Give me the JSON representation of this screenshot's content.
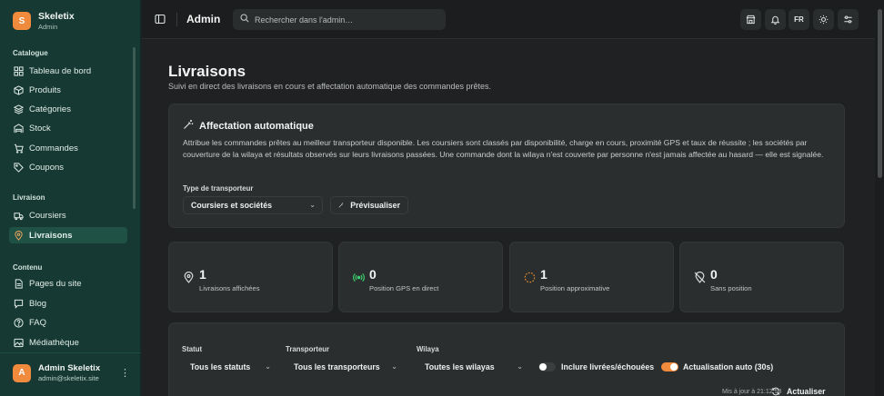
{
  "brand": {
    "logo_letter": "S",
    "title": "Skeletix",
    "subtitle": "Admin"
  },
  "sidebar": {
    "sections": [
      {
        "label": "Catalogue"
      },
      {
        "label": "Livraison"
      },
      {
        "label": "Contenu"
      }
    ],
    "items": [
      {
        "label": "Tableau de bord",
        "icon": "dashboard-icon"
      },
      {
        "label": "Produits",
        "icon": "box-icon"
      },
      {
        "label": "Catégories",
        "icon": "layers-icon"
      },
      {
        "label": "Stock",
        "icon": "warehouse-icon"
      },
      {
        "label": "Commandes",
        "icon": "cart-icon"
      },
      {
        "label": "Coupons",
        "icon": "tag-icon"
      },
      {
        "label": "Coursiers",
        "icon": "truck-icon"
      },
      {
        "label": "Livraisons",
        "icon": "map-pin-icon",
        "active": true
      },
      {
        "label": "Pages du site",
        "icon": "file-icon"
      },
      {
        "label": "Blog",
        "icon": "chat-icon"
      },
      {
        "label": "FAQ",
        "icon": "help-icon"
      },
      {
        "label": "Médiathèque",
        "icon": "image-icon"
      }
    ]
  },
  "user": {
    "avatar_letter": "A",
    "name": "Admin Skeletix",
    "email": "admin@skeletix.site"
  },
  "topbar": {
    "title": "Admin",
    "search_placeholder": "Rechercher dans l'admin…",
    "language": "FR"
  },
  "page": {
    "title": "Livraisons",
    "subtitle": "Suivi en direct des livraisons en cours et affectation automatique des commandes prêtes."
  },
  "auto_assign": {
    "title": "Affectation automatique",
    "description": "Attribue les commandes prêtes au meilleur transporteur disponible. Les coursiers sont classés par disponibilité, charge en cours, proximité GPS et taux de réussite ; les sociétés par couverture de la wilaya et résultats observés sur leurs livraisons passées. Une commande dont la wilaya n'est couverte par personne n'est jamais affectée au hasard — elle est signalée.",
    "carrier_type_label": "Type de transporteur",
    "carrier_type_value": "Coursiers et sociétés",
    "preview_label": "Prévisualiser"
  },
  "stats": [
    {
      "value": "1",
      "label": "Livraisons affichées",
      "icon": "map-pin-icon"
    },
    {
      "value": "0",
      "label": "Position GPS en direct",
      "icon": "radio-signal-icon"
    },
    {
      "value": "1",
      "label": "Position approximative",
      "icon": "dashed-circle-icon"
    },
    {
      "value": "0",
      "label": "Sans position",
      "icon": "no-location-icon"
    }
  ],
  "filters": {
    "status_label": "Statut",
    "status_value": "Tous les statuts",
    "carrier_label": "Transporteur",
    "carrier_value": "Tous les transporteurs",
    "wilaya_label": "Wilaya",
    "wilaya_value": "Toutes les wilayas",
    "include_label": "Inclure livrées/échouées",
    "include_on": false,
    "auto_refresh_label": "Actualisation auto (30s)",
    "auto_refresh_on": true,
    "updated_text": "Mis à jour à 21:12:58",
    "refresh_label": "Actualiser"
  },
  "colors": {
    "accent": "#f08a3c",
    "sidebar_bg": "#163a33",
    "gps_green": "#3ccf6d",
    "approx_orange": "#e38a2e"
  }
}
